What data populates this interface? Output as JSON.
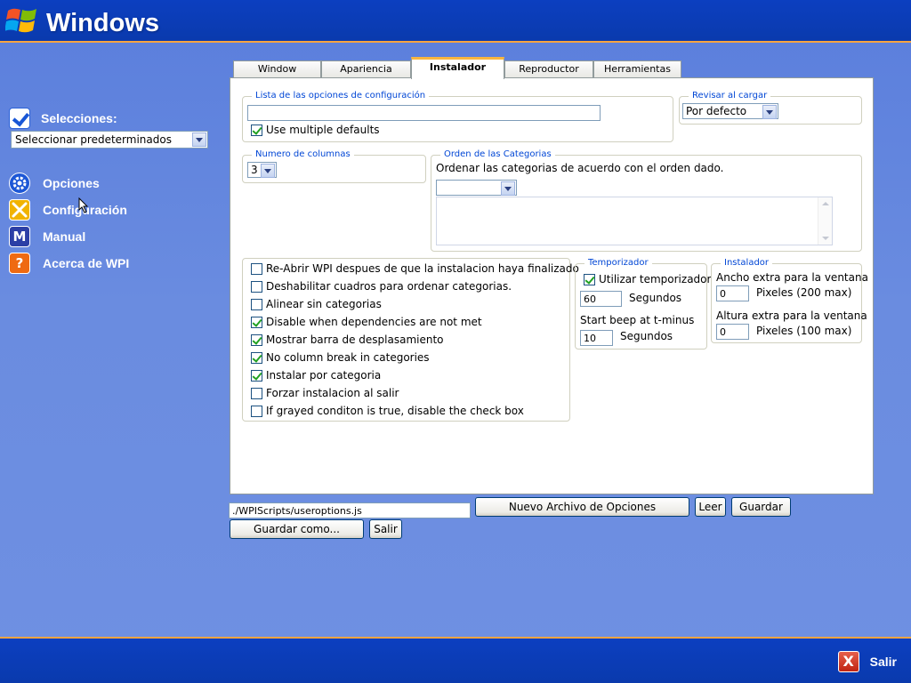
{
  "header": {
    "brand": "Windows"
  },
  "sidebar": {
    "selecciones_label": "Selecciones:",
    "selecciones_value": "Seleccionar predeterminados",
    "items": [
      {
        "label": "Opciones",
        "icon": "gear-icon",
        "color": "#1c57d6"
      },
      {
        "label": "Configuración",
        "icon": "tools-icon",
        "color": "#f1b300"
      },
      {
        "label": "Manual",
        "icon": "manual-icon",
        "color": "#2c3fa6"
      },
      {
        "label": "Acerca de WPI",
        "icon": "help-icon",
        "color": "#ef6a12"
      }
    ]
  },
  "tabs": [
    {
      "label": "Window",
      "active": false
    },
    {
      "label": "Apariencia",
      "active": false
    },
    {
      "label": "Instalador",
      "active": true
    },
    {
      "label": "Reproductor",
      "active": false
    },
    {
      "label": "Herramientas",
      "active": false
    }
  ],
  "config_list": {
    "legend": "Lista de las opciones de configuración",
    "value": "",
    "multiple_defaults": {
      "label": "Use multiple defaults",
      "checked": true
    }
  },
  "revisar": {
    "legend": "Revisar al cargar",
    "value": "Por defecto"
  },
  "columnas": {
    "legend": "Numero de columnas",
    "value": "3"
  },
  "orden": {
    "legend": "Orden de las Categorias",
    "description": "Ordenar las categorias de acuerdo con el orden dado.",
    "value": ""
  },
  "options": [
    {
      "label": "Re-Abrir WPI despues de que la instalacion haya finalizado",
      "checked": false
    },
    {
      "label": "Deshabilitar cuadros para ordenar categorias.",
      "checked": false
    },
    {
      "label": "Alinear sin categorias",
      "checked": false
    },
    {
      "label": "Disable when dependencies are not met",
      "checked": true
    },
    {
      "label": "Mostrar barra de desplasamiento",
      "checked": true
    },
    {
      "label": "No column break in categories",
      "checked": true
    },
    {
      "label": "Instalar por categoria",
      "checked": true
    },
    {
      "label": "Forzar instalacion al salir",
      "checked": false
    },
    {
      "label": "If grayed conditon is true, disable the check box",
      "checked": false
    }
  ],
  "temporizador": {
    "legend": "Temporizador",
    "utilizar": {
      "label": "Utilizar temporizador",
      "checked": true
    },
    "seconds_value": "60",
    "seconds_label": "Segundos",
    "beep_label": "Start beep at t-minus",
    "beep_value": "10",
    "beep_unit": "Segundos"
  },
  "instalador_box": {
    "legend": "Instalador",
    "ancho_label": "Ancho extra para la ventana",
    "ancho_value": "0",
    "ancho_unit": "Pixeles (200 max)",
    "altura_label": "Altura extra para la ventana",
    "altura_value": "0",
    "altura_unit": "Pixeles (100 max)"
  },
  "footer": {
    "path": "./WPIScripts/useroptions.js",
    "nuevo": "Nuevo Archivo de Opciones",
    "leer": "Leer",
    "guardar": "Guardar",
    "guardar_como": "Guardar como...",
    "salir": "Salir"
  },
  "bottom": {
    "exit_label": "Salir"
  }
}
